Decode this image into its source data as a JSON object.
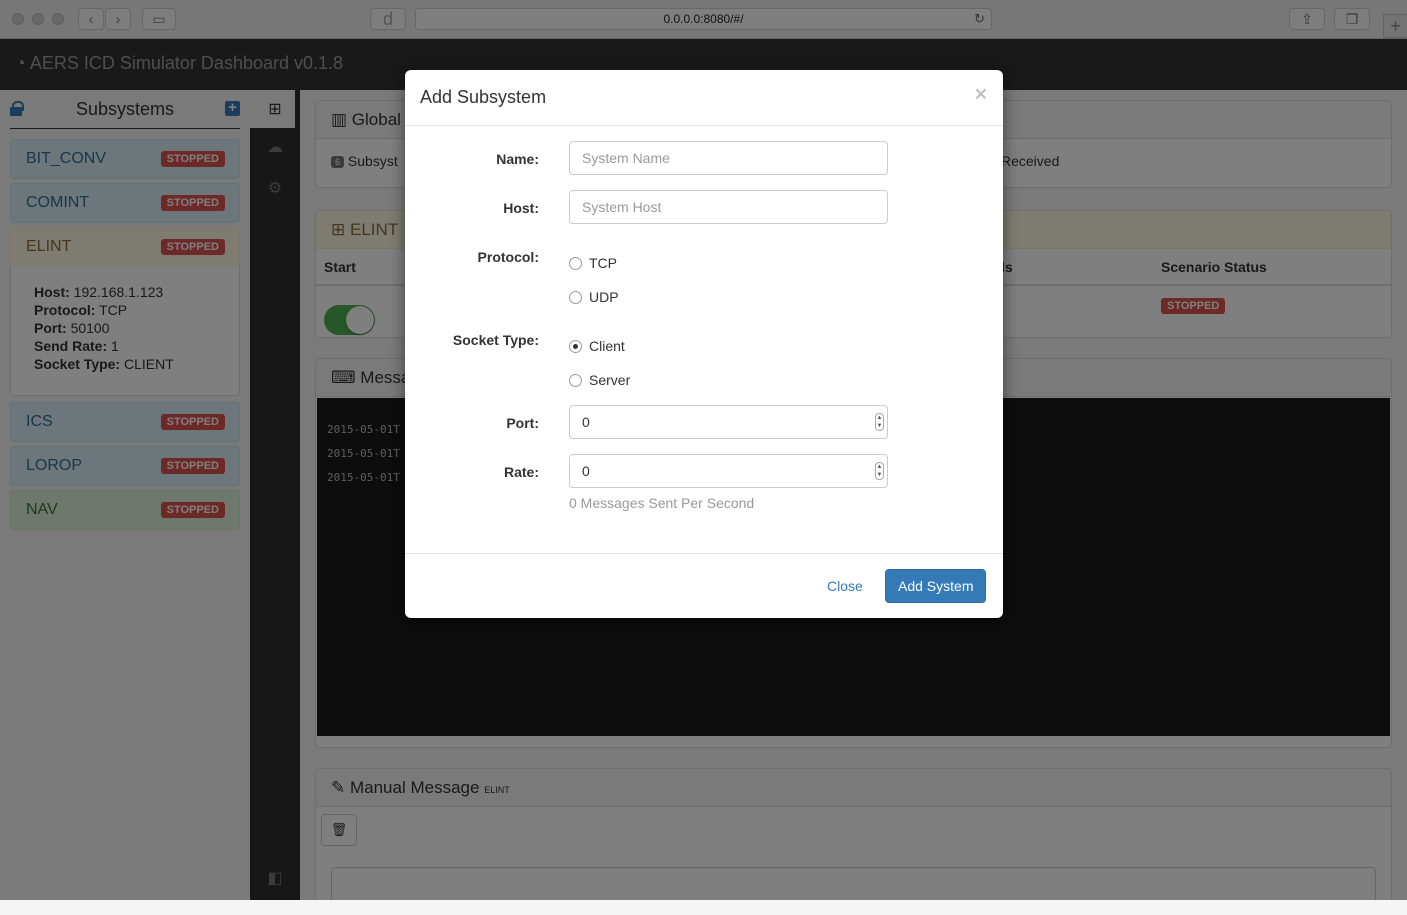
{
  "browser": {
    "url": "0.0.0.0:8080/#/",
    "reload_glyph": "↻",
    "logo_glyph": "d",
    "newtab_glyph": "+"
  },
  "app": {
    "title": "AERS ICD Simulator Dashboard v0.1.8"
  },
  "sidebar": {
    "title": "Subsystems",
    "items": [
      {
        "name": "BIT_CONV",
        "status": "STOPPED"
      },
      {
        "name": "COMINT",
        "status": "STOPPED"
      },
      {
        "name": "ELINT",
        "status": "STOPPED"
      },
      {
        "name": "ICS",
        "status": "STOPPED"
      },
      {
        "name": "LOROP",
        "status": "STOPPED"
      },
      {
        "name": "NAV",
        "status": "STOPPED"
      }
    ],
    "selected_detail": {
      "host_label": "Host:",
      "host": "192.168.1.123",
      "protocol_label": "Protocol:",
      "protocol": "TCP",
      "port_label": "Port:",
      "port": "50100",
      "rate_label": "Send Rate:",
      "rate": "1",
      "socket_label": "Socket Type:",
      "socket": "CLIENT"
    }
  },
  "main": {
    "global_panel": {
      "title": "Global",
      "count_badge": "6",
      "subsystems_text": "Subsyst",
      "received_text": "Received"
    },
    "elint_panel": {
      "title": "ELINT",
      "col_start": "Start",
      "col_partial": "ls",
      "col_scenario": "Scenario Status",
      "scenario_status": "STOPPED"
    },
    "messages_panel": {
      "title": "Messag",
      "lines": [
        "2015-05-01T",
        "2015-05-01T",
        "2015-05-01T"
      ]
    },
    "manual_panel": {
      "title": "Manual Message",
      "subtitle": "ELINT"
    }
  },
  "modal": {
    "title": "Add Subsystem",
    "close_glyph": "×",
    "name_label": "Name:",
    "name_placeholder": "System Name",
    "host_label": "Host:",
    "host_placeholder": "System Host",
    "protocol_label": "Protocol:",
    "protocol_options": [
      "TCP",
      "UDP"
    ],
    "socket_label": "Socket Type:",
    "socket_options": [
      "Client",
      "Server"
    ],
    "socket_selected": "Client",
    "port_label": "Port:",
    "port_value": "0",
    "rate_label": "Rate:",
    "rate_value": "0",
    "rate_help": "0 Messages Sent Per Second",
    "close_button": "Close",
    "add_button": "Add System"
  },
  "colors": {
    "accent": "#337ab7",
    "danger": "#d9534f",
    "toggle_on": "#4caf50"
  }
}
